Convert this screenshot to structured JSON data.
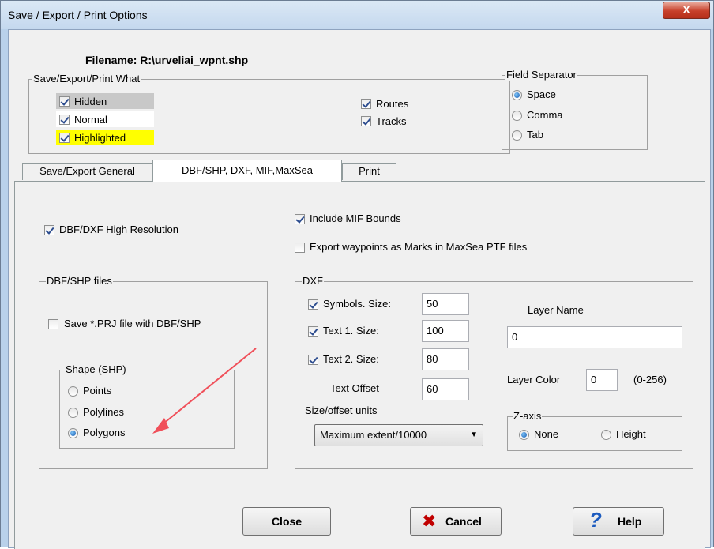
{
  "window": {
    "title": "Save / Export / Print Options",
    "close_glyph": "X"
  },
  "filename": "Filename:  R:\\urveliai_wpnt.shp",
  "what_group": {
    "legend": "Save/Export/Print What",
    "hidden": "Hidden",
    "normal": "Normal",
    "highlighted": "Highlighted",
    "routes": "Routes",
    "tracks": "Tracks"
  },
  "separator_group": {
    "legend": "Field Separator",
    "space": "Space",
    "comma": "Comma",
    "tab": "Tab"
  },
  "tabs": [
    "Save/Export General",
    "DBF/SHP, DXF, MIF,MaxSea",
    "Print"
  ],
  "panel": {
    "dbf_high_res": "DBF/DXF High Resolution",
    "include_mif_bounds": "Include MIF Bounds",
    "export_waypoints": "Export waypoints as Marks  in MaxSea PTF files",
    "dbf_shp_group": {
      "legend": "DBF/SHP files",
      "save_prj": "Save *.PRJ file with DBF/SHP",
      "shape_legend": "Shape (SHP)",
      "points": "Points",
      "polylines": "Polylines",
      "polygons": "Polygons"
    },
    "dxf_group": {
      "legend": "DXF",
      "symbols_label": "Symbols. Size:",
      "symbols_value": "50",
      "text1_label": "Text 1.    Size:",
      "text1_value": "100",
      "text2_label": "Text 2.    Size:",
      "text2_value": "80",
      "text_offset_label": "Text Offset",
      "text_offset_value": "60",
      "units_label": "Size/offset units",
      "units_value": "Maximum extent/10000",
      "layer_name_label": "Layer Name",
      "layer_name_value": "0",
      "layer_color_label": "Layer Color",
      "layer_color_value": "0",
      "layer_color_range": "(0-256)",
      "zaxis_legend": "Z-axis",
      "none": "None",
      "height": "Height"
    }
  },
  "buttons": {
    "close": "Close",
    "cancel": "Cancel",
    "help": "Help"
  },
  "colors": {
    "highlight_yellow": "#ffff00",
    "annotation_arrow": "#f0505a",
    "cancel_icon": "#c00000",
    "help_icon": "#1c5bbf"
  },
  "icons": {
    "cancel": "x-icon",
    "help": "question-icon",
    "annotation": "arrow-annotation-icon"
  }
}
